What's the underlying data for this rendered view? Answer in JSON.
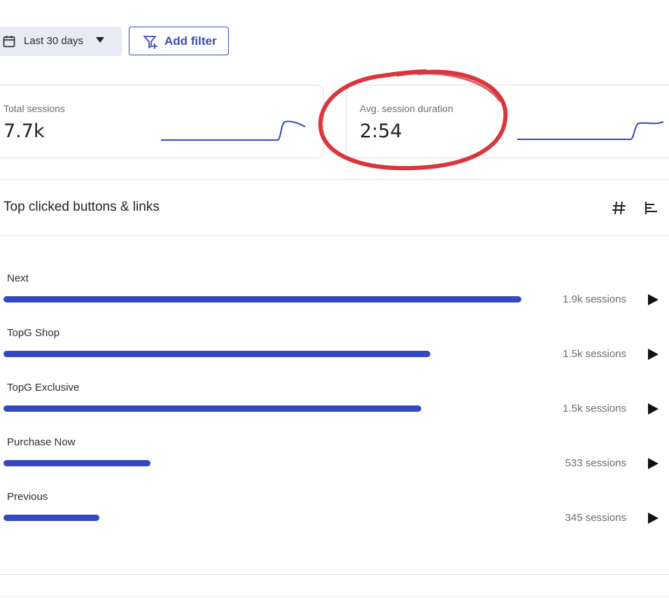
{
  "toolbar": {
    "date_range_label": "Last 30 days",
    "add_filter_label": "Add filter"
  },
  "stats": [
    {
      "label": "Total sessions",
      "value": "7.7k"
    },
    {
      "label": "Avg. session duration",
      "value": "2:54"
    }
  ],
  "colors": {
    "accent": "#3348c0",
    "annotation": "#d9363e",
    "date_button_bg": "#e8ebf6"
  },
  "section": {
    "title": "Top clicked buttons & links",
    "view_icons": [
      "hash-icon",
      "bar-list-icon"
    ]
  },
  "rows": [
    {
      "label": "Next",
      "count": "1.9k sessions",
      "fill": 1.0
    },
    {
      "label": "TopG Shop",
      "count": "1.5k sessions",
      "fill": 0.824
    },
    {
      "label": "TopG Exclusive",
      "count": "1.5k sessions",
      "fill": 0.807
    },
    {
      "label": "Purchase Now",
      "count": "533 sessions",
      "fill": 0.284
    },
    {
      "label": "Previous",
      "count": "345 sessions",
      "fill": 0.185
    }
  ]
}
